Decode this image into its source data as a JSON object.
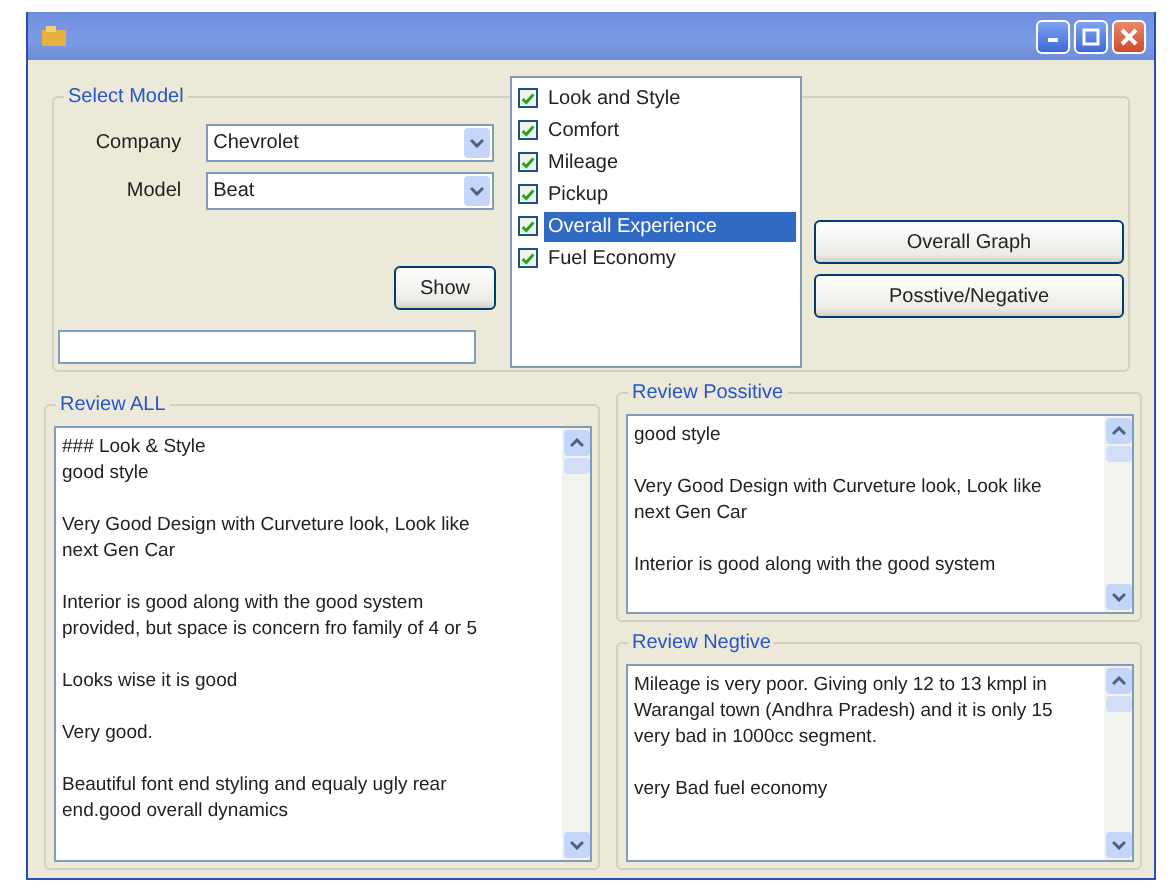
{
  "select_model": {
    "title": "Select Model",
    "fields": [
      {
        "label": "Company",
        "value": "Chevrolet"
      },
      {
        "label": "Model",
        "value": "Beat"
      }
    ],
    "show_button": "Show"
  },
  "aspects": [
    {
      "label": "Look and Style",
      "checked": true,
      "selected": false
    },
    {
      "label": "Comfort",
      "checked": true,
      "selected": false
    },
    {
      "label": "Mileage",
      "checked": true,
      "selected": false
    },
    {
      "label": "Pickup",
      "checked": true,
      "selected": false
    },
    {
      "label": "Overall Experience",
      "checked": true,
      "selected": true
    },
    {
      "label": "Fuel Economy",
      "checked": true,
      "selected": false
    }
  ],
  "buttons": [
    "Overall Graph",
    "Posstive/Negative"
  ],
  "reviews": [
    {
      "title": "Review ALL",
      "paragraphs": [
        [
          "### Look & Style",
          "good style"
        ],
        [
          "Very Good Design with Curveture look, Look like",
          "next Gen Car"
        ],
        [
          "Interior is good along with the good system",
          "provided, but space is concern fro family of 4 or 5"
        ],
        [
          "Looks wise it is good"
        ],
        [
          "Very good."
        ],
        [
          "Beautiful font end styling and equaly ugly rear",
          "end.good overall dynamics"
        ]
      ]
    },
    {
      "title": "Review Possitive",
      "paragraphs": [
        [
          "good style"
        ],
        [
          "Very Good Design with Curveture look, Look like",
          "next Gen Car"
        ],
        [
          "Interior is good along with the good system"
        ]
      ]
    },
    {
      "title": "Review Negtive",
      "paragraphs": [
        [
          "Mileage is very poor. Giving only 12 to 13 kmpl in",
          "Warangal town (Andhra Pradesh)  and it is only 15",
          "very bad in 1000cc segment."
        ],
        [
          "very Bad fuel economy"
        ]
      ]
    }
  ]
}
